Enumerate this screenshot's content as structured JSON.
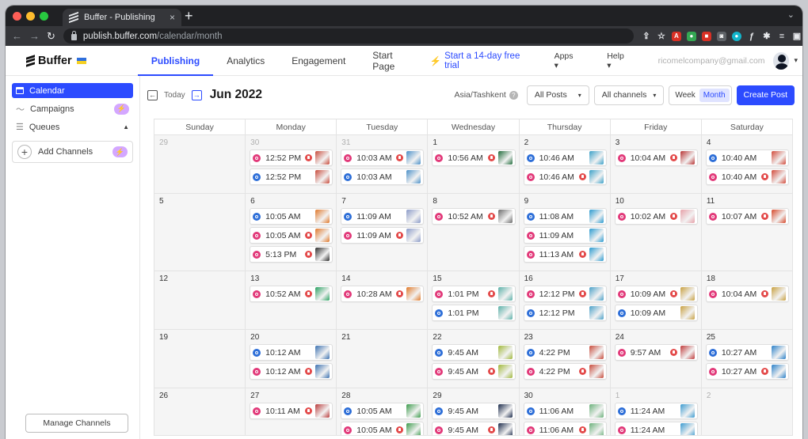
{
  "browser": {
    "tab_title": "Buffer - Publishing",
    "url_host": "publish.buffer.com",
    "url_path": "/calendar/month"
  },
  "appnav": {
    "logo": "Buffer",
    "items": [
      "Publishing",
      "Analytics",
      "Engagement",
      "Start Page"
    ],
    "trial": "Start a 14-day free trial",
    "apps": "Apps",
    "help": "Help",
    "email": "ricomelcompany@gmail.com"
  },
  "sidebar": {
    "calendar": "Calendar",
    "campaigns": "Campaigns",
    "queues": "Queues",
    "add_channels": "Add Channels",
    "manage_channels": "Manage Channels"
  },
  "toolbar": {
    "today": "Today",
    "month": "Jun 2022",
    "timezone": "Asia/Tashkent",
    "posts_filter": "All Posts",
    "channels_filter": "All channels",
    "week": "Week",
    "month_view": "Month",
    "create": "Create Post"
  },
  "calendar": {
    "weekdays": [
      "Sunday",
      "Monday",
      "Tuesday",
      "Wednesday",
      "Thursday",
      "Friday",
      "Saturday"
    ],
    "weeks": [
      {
        "days": [
          {
            "d": "29",
            "muted": true,
            "posts": []
          },
          {
            "d": "30",
            "muted": true,
            "posts": [
              {
                "t": "12:52 PM",
                "ch": "ig",
                "r": true,
                "th": "#c84a3a"
              },
              {
                "t": "12:52 PM",
                "ch": "fb",
                "r": false,
                "th": "#c84a3a"
              }
            ]
          },
          {
            "d": "31",
            "muted": true,
            "posts": [
              {
                "t": "10:03 AM",
                "ch": "ig",
                "r": true,
                "th": "#4a8fc8"
              },
              {
                "t": "10:03 AM",
                "ch": "fb",
                "r": false,
                "th": "#4a8fc8"
              }
            ]
          },
          {
            "d": "1",
            "posts": [
              {
                "t": "10:56 AM",
                "ch": "ig",
                "r": true,
                "th": "#1f6b3a"
              }
            ]
          },
          {
            "d": "2",
            "posts": [
              {
                "t": "10:46 AM",
                "ch": "fb",
                "r": false,
                "th": "#3aa0c8"
              },
              {
                "t": "10:46 AM",
                "ch": "ig",
                "r": true,
                "th": "#3aa0c8"
              }
            ]
          },
          {
            "d": "3",
            "posts": [
              {
                "t": "10:04 AM",
                "ch": "ig",
                "r": true,
                "th": "#b83232"
              }
            ]
          },
          {
            "d": "4",
            "posts": [
              {
                "t": "10:40 AM",
                "ch": "fb",
                "r": false,
                "th": "#d24a3a"
              },
              {
                "t": "10:40 AM",
                "ch": "ig",
                "r": true,
                "th": "#d24a3a"
              }
            ]
          }
        ]
      },
      {
        "days": [
          {
            "d": "5",
            "posts": []
          },
          {
            "d": "6",
            "posts": [
              {
                "t": "10:05 AM",
                "ch": "fb",
                "r": false,
                "th": "#e0782a"
              },
              {
                "t": "10:05 AM",
                "ch": "ig",
                "r": true,
                "th": "#e0782a"
              },
              {
                "t": "5:13 PM",
                "ch": "ig",
                "r": true,
                "th": "#2b2b2b"
              }
            ]
          },
          {
            "d": "7",
            "posts": [
              {
                "t": "11:09 AM",
                "ch": "fb",
                "r": false,
                "th": "#8a9ac8"
              },
              {
                "t": "11:09 AM",
                "ch": "ig",
                "r": true,
                "th": "#8a9ac8"
              }
            ]
          },
          {
            "d": "8",
            "posts": [
              {
                "t": "10:52 AM",
                "ch": "ig",
                "r": true,
                "th": "#6b6b6b"
              }
            ]
          },
          {
            "d": "9",
            "posts": [
              {
                "t": "11:08 AM",
                "ch": "fb",
                "r": false,
                "th": "#2a9ad0"
              },
              {
                "t": "11:09 AM",
                "ch": "ig",
                "r": false,
                "th": "#2a9ad0"
              },
              {
                "t": "11:13 AM",
                "ch": "ig",
                "r": true,
                "th": "#2a9ad0"
              }
            ]
          },
          {
            "d": "10",
            "posts": [
              {
                "t": "10:02 AM",
                "ch": "ig",
                "r": true,
                "th": "#e6a0a8"
              }
            ]
          },
          {
            "d": "11",
            "posts": [
              {
                "t": "10:07 AM",
                "ch": "ig",
                "r": true,
                "th": "#d6482a"
              }
            ]
          }
        ]
      },
      {
        "days": [
          {
            "d": "12",
            "posts": []
          },
          {
            "d": "13",
            "posts": [
              {
                "t": "10:52 AM",
                "ch": "ig",
                "r": true,
                "th": "#28a060"
              }
            ]
          },
          {
            "d": "14",
            "posts": [
              {
                "t": "10:28 AM",
                "ch": "ig",
                "r": true,
                "th": "#e07a2a"
              }
            ]
          },
          {
            "d": "15",
            "posts": [
              {
                "t": "1:01 PM",
                "ch": "ig",
                "r": true,
                "th": "#5ab0a8"
              },
              {
                "t": "1:01 PM",
                "ch": "fb",
                "r": false,
                "th": "#5ab0a8"
              }
            ]
          },
          {
            "d": "16",
            "posts": [
              {
                "t": "12:12 PM",
                "ch": "ig",
                "r": true,
                "th": "#4aa0c8"
              },
              {
                "t": "12:12 PM",
                "ch": "fb",
                "r": false,
                "th": "#4aa0c8"
              }
            ]
          },
          {
            "d": "17",
            "posts": [
              {
                "t": "10:09 AM",
                "ch": "ig",
                "r": true,
                "th": "#c8a040"
              },
              {
                "t": "10:09 AM",
                "ch": "fb",
                "r": false,
                "th": "#c8a040"
              }
            ]
          },
          {
            "d": "18",
            "posts": [
              {
                "t": "10:04 AM",
                "ch": "ig",
                "r": true,
                "th": "#c8a040"
              }
            ]
          }
        ]
      },
      {
        "days": [
          {
            "d": "19",
            "posts": []
          },
          {
            "d": "20",
            "posts": [
              {
                "t": "10:12 AM",
                "ch": "fb",
                "r": false,
                "th": "#3a70b0"
              },
              {
                "t": "10:12 AM",
                "ch": "ig",
                "r": true,
                "th": "#3a70b0"
              }
            ]
          },
          {
            "d": "21",
            "posts": []
          },
          {
            "d": "22",
            "posts": [
              {
                "t": "9:45 AM",
                "ch": "fb",
                "r": false,
                "th": "#a0b83a"
              },
              {
                "t": "9:45 AM",
                "ch": "ig",
                "r": true,
                "th": "#a0b83a"
              }
            ]
          },
          {
            "d": "23",
            "posts": [
              {
                "t": "4:22 PM",
                "ch": "fb",
                "r": false,
                "th": "#c84a3a"
              },
              {
                "t": "4:22 PM",
                "ch": "ig",
                "r": true,
                "th": "#c84a3a"
              }
            ]
          },
          {
            "d": "24",
            "posts": [
              {
                "t": "9:57 AM",
                "ch": "ig",
                "r": true,
                "th": "#c03a3a"
              }
            ]
          },
          {
            "d": "25",
            "posts": [
              {
                "t": "10:27 AM",
                "ch": "fb",
                "r": false,
                "th": "#2a80c8"
              },
              {
                "t": "10:27 AM",
                "ch": "ig",
                "r": true,
                "th": "#2a80c8"
              }
            ]
          }
        ]
      },
      {
        "days": [
          {
            "d": "26",
            "posts": []
          },
          {
            "d": "27",
            "posts": [
              {
                "t": "10:11 AM",
                "ch": "ig",
                "r": true,
                "th": "#b83a3a"
              }
            ]
          },
          {
            "d": "28",
            "posts": [
              {
                "t": "10:05 AM",
                "ch": "fb",
                "r": false,
                "th": "#3a9a4a"
              },
              {
                "t": "10:05 AM",
                "ch": "ig",
                "r": true,
                "th": "#3a9a4a"
              }
            ]
          },
          {
            "d": "29",
            "posts": [
              {
                "t": "9:45 AM",
                "ch": "fb",
                "r": false,
                "th": "#1a2a4a"
              },
              {
                "t": "9:45 AM",
                "ch": "ig",
                "r": true,
                "th": "#1a2a4a"
              }
            ]
          },
          {
            "d": "30",
            "posts": [
              {
                "t": "11:06 AM",
                "ch": "fb",
                "r": false,
                "th": "#6ab07a"
              },
              {
                "t": "11:06 AM",
                "ch": "ig",
                "r": true,
                "th": "#6ab07a"
              }
            ]
          },
          {
            "d": "1",
            "muted": true,
            "posts": [
              {
                "t": "11:24 AM",
                "ch": "fb",
                "r": false,
                "th": "#3a9ad0"
              },
              {
                "t": "11:24 AM",
                "ch": "ig",
                "r": false,
                "th": "#3a9ad0"
              }
            ]
          },
          {
            "d": "2",
            "muted": true,
            "posts": []
          }
        ]
      }
    ]
  }
}
